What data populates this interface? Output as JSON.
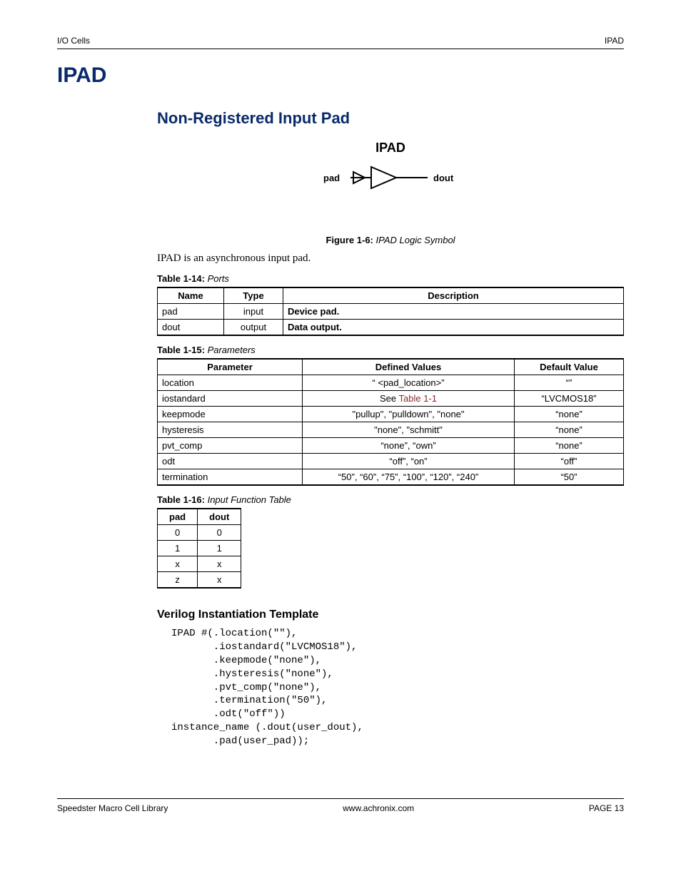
{
  "header": {
    "left": "I/O Cells",
    "right": "IPAD"
  },
  "title": "IPAD",
  "subtitle": "Non-Registered Input Pad",
  "figure": {
    "label": "IPAD",
    "pin_left": "pad",
    "pin_right": "dout",
    "caption_prefix": "Figure 1-6:",
    "caption_text": "IPAD Logic Symbol"
  },
  "intro": "IPAD is an asynchronous input pad.",
  "tables": {
    "ports": {
      "caption_prefix": "Table 1-14:",
      "caption_text": "Ports",
      "headers": [
        "Name",
        "Type",
        "Description"
      ],
      "rows": [
        {
          "c0": "pad",
          "c1": "input",
          "c2": "Device pad."
        },
        {
          "c0": "dout",
          "c1": "output",
          "c2": "Data output."
        }
      ]
    },
    "params": {
      "caption_prefix": "Table 1-15:",
      "caption_text": "Parameters",
      "headers": [
        "Parameter",
        "Defined Values",
        "Default Value"
      ],
      "rows": [
        {
          "c0": "location",
          "c1": "“ <pad_location>”",
          "c2": "“”",
          "link": false
        },
        {
          "c0": "iostandard",
          "c1_pre": "See ",
          "c1_link": "Table 1-1",
          "c2": "“LVCMOS18”",
          "link": true
        },
        {
          "c0": "keepmode",
          "c1": "\"pullup\", \"pulldown\", \"none\"",
          "c2": "“none”",
          "link": false
        },
        {
          "c0": "hysteresis",
          "c1": "\"none\", \"schmitt\"",
          "c2": "“none”",
          "link": false
        },
        {
          "c0": "pvt_comp",
          "c1": "“none”, “own”",
          "c2": "“none”",
          "link": false
        },
        {
          "c0": "odt",
          "c1": "“off”, “on”",
          "c2": "“off”",
          "link": false
        },
        {
          "c0": "termination",
          "c1": "“50”, “60”, “75”, “100”, “120”, “240”",
          "c2": "“50”",
          "link": false
        }
      ]
    },
    "func": {
      "caption_prefix": "Table 1-16:",
      "caption_text": "Input Function Table",
      "headers": [
        "pad",
        "dout"
      ],
      "rows": [
        {
          "c0": "0",
          "c1": "0"
        },
        {
          "c0": "1",
          "c1": "1"
        },
        {
          "c0": "x",
          "c1": "x"
        },
        {
          "c0": "z",
          "c1": "x"
        }
      ]
    }
  },
  "template": {
    "heading": "Verilog Instantiation Template",
    "code": "IPAD #(.location(\"\"),\n       .iostandard(\"LVCMOS18\"),\n       .keepmode(\"none\"),\n       .hysteresis(\"none\"),\n       .pvt_comp(\"none\"),\n       .termination(\"50\"),\n       .odt(\"off\"))\ninstance_name (.dout(user_dout),\n       .pad(user_pad));"
  },
  "footer": {
    "left": "Speedster Macro Cell Library",
    "center": "www.achronix.com",
    "right": "PAGE 13"
  }
}
